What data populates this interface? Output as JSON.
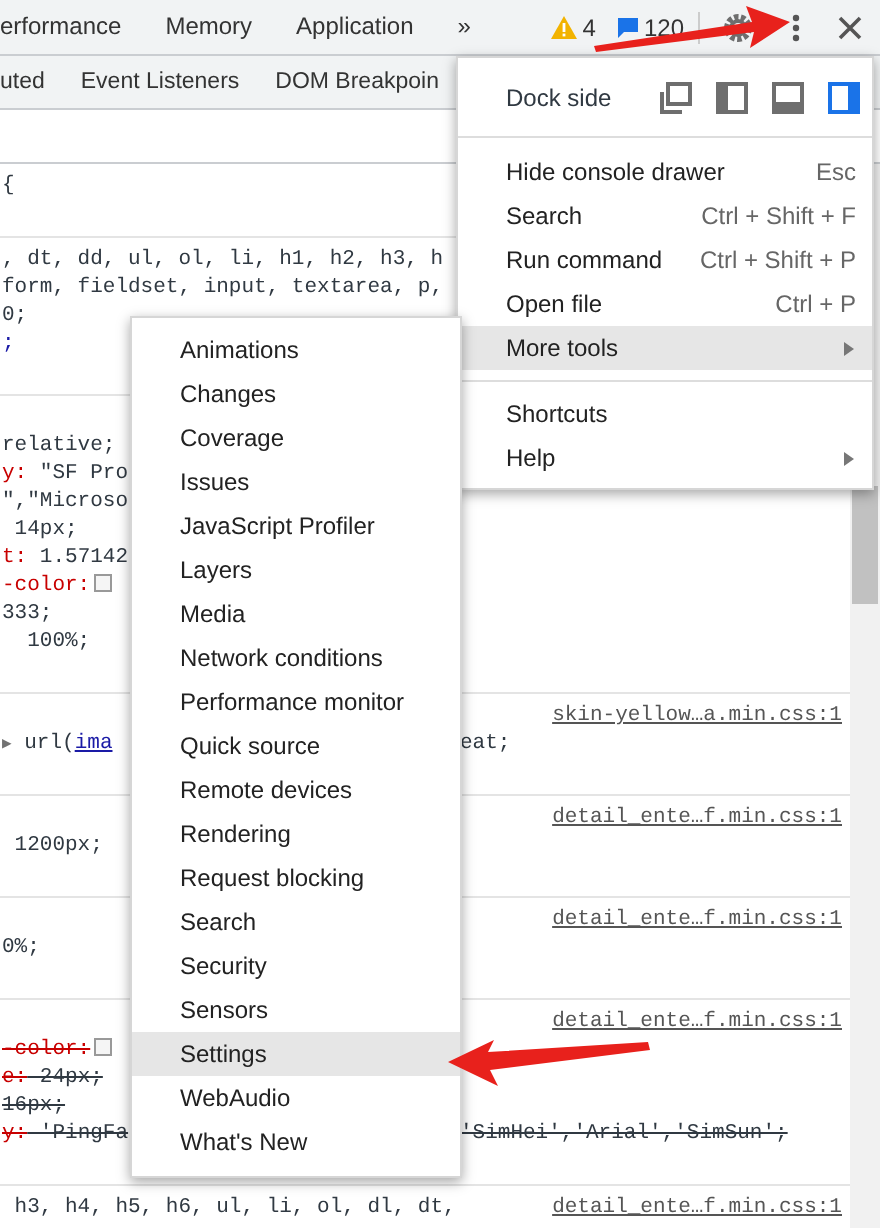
{
  "toolbar": {
    "tabs": [
      {
        "label": "erformance"
      },
      {
        "label": "Memory"
      },
      {
        "label": "Application"
      }
    ],
    "overflow": "»",
    "warnings": "4",
    "messages": "120"
  },
  "subtabs": [
    {
      "label": "uted"
    },
    {
      "label": "Event Listeners"
    },
    {
      "label": "DOM Breakpoin"
    }
  ],
  "rules": [
    {
      "header": [
        {
          "kind": "value",
          "text": "{"
        }
      ]
    },
    {
      "header": [
        {
          "kind": "value",
          "text": ", dt, dd, ul, ol, li, h1, h2, h3, h"
        }
      ],
      "lines": [
        {
          "struck": false,
          "segments": [
            {
              "kind": "value",
              "text": "form, fieldset, input, textarea, p,"
            }
          ]
        },
        {
          "struck": false,
          "segments": [
            {
              "kind": "value",
              "text": "0;"
            }
          ]
        },
        {
          "struck": false,
          "segments": [
            {
              "kind": "punct",
              "text": ";"
            }
          ]
        }
      ]
    },
    {
      "lines": [
        {
          "struck": false,
          "segments": [
            {
              "kind": "value",
              "text": "relative;"
            }
          ]
        },
        {
          "struck": false,
          "segments": [
            {
              "kind": "prop",
              "text": "y:"
            },
            {
              "kind": "value",
              "text": " \"SF Pro"
            }
          ]
        },
        {
          "struck": false,
          "segments": [
            {
              "kind": "value",
              "text": "\",\"Microso"
            }
          ]
        },
        {
          "struck": false,
          "segments": [
            {
              "kind": "value",
              "text": " 14px;"
            }
          ]
        },
        {
          "struck": false,
          "segments": [
            {
              "kind": "prop",
              "text": "t:"
            },
            {
              "kind": "value",
              "text": " 1.57142"
            }
          ]
        },
        {
          "struck": false,
          "segments": [
            {
              "kind": "prop",
              "text": "-color:"
            },
            {
              "kind": "swatch"
            }
          ]
        },
        {
          "struck": false,
          "segments": [
            {
              "kind": "value",
              "text": "333;"
            }
          ]
        },
        {
          "struck": false,
          "segments": [
            {
              "kind": "value",
              "text": "  100%;"
            }
          ]
        }
      ]
    },
    {
      "source": "skin-yellow…a.min.css:1",
      "lines": [
        {
          "struck": false,
          "segments": [
            {
              "kind": "toggle",
              "text": "▶"
            },
            {
              "kind": "value",
              "text": " url("
            },
            {
              "kind": "link",
              "text": "ima"
            }
          ],
          "right": [
            {
              "kind": "value",
              "text": "eat;"
            }
          ]
        }
      ]
    },
    {
      "source": "detail_ente…f.min.css:1",
      "lines": [
        {
          "struck": false,
          "segments": [
            {
              "kind": "value",
              "text": " 1200px;"
            }
          ]
        }
      ]
    },
    {
      "source": "detail_ente…f.min.css:1",
      "lines": [
        {
          "struck": false,
          "segments": [
            {
              "kind": "value",
              "text": "0%;"
            }
          ]
        }
      ]
    },
    {
      "source": "detail_ente…f.min.css:1",
      "lines": [
        {
          "struck": true,
          "segments": [
            {
              "kind": "prop",
              "text": "-color:"
            },
            {
              "kind": "swatch"
            }
          ]
        },
        {
          "struck": true,
          "segments": [
            {
              "kind": "prop",
              "text": "e:"
            },
            {
              "kind": "value",
              "text": " 24px;"
            }
          ]
        },
        {
          "struck": true,
          "segments": [
            {
              "kind": "value",
              "text": "16px;"
            }
          ]
        },
        {
          "struck": true,
          "segments": [
            {
              "kind": "prop",
              "text": "y:"
            },
            {
              "kind": "value",
              "text": " 'PingFa"
            }
          ],
          "right": [
            {
              "kind": "value",
              "text": "'SimHei','Arial','SimSun';"
            }
          ]
        }
      ]
    },
    {
      "header": [
        {
          "kind": "value",
          "text": " h3, h4, h5, h6, ul, li, ol, dl, dt,"
        }
      ],
      "source": "detail_ente…f.min.css:1"
    }
  ],
  "main_menu": {
    "dock_label": "Dock side",
    "dock_options": [
      {
        "kind": "undock",
        "selected": false
      },
      {
        "kind": "left",
        "selected": false
      },
      {
        "kind": "bottom",
        "selected": false
      },
      {
        "kind": "right",
        "selected": true
      }
    ],
    "groups": [
      [
        {
          "label": "Hide console drawer",
          "shortcut": "Esc",
          "has_submenu": false,
          "highlighted": false
        },
        {
          "label": "Search",
          "shortcut": "Ctrl + Shift + F",
          "has_submenu": false,
          "highlighted": false
        },
        {
          "label": "Run command",
          "shortcut": "Ctrl + Shift + P",
          "has_submenu": false,
          "highlighted": false
        },
        {
          "label": "Open file",
          "shortcut": "Ctrl + P",
          "has_submenu": false,
          "highlighted": false
        },
        {
          "label": "More tools",
          "has_submenu": true,
          "highlighted": true
        }
      ],
      [
        {
          "label": "Shortcuts",
          "has_submenu": false,
          "highlighted": false
        },
        {
          "label": "Help",
          "has_submenu": true,
          "highlighted": false
        }
      ]
    ]
  },
  "more_tools_menu": {
    "items": [
      {
        "label": "Animations",
        "highlighted": false
      },
      {
        "label": "Changes",
        "highlighted": false
      },
      {
        "label": "Coverage",
        "highlighted": false
      },
      {
        "label": "Issues",
        "highlighted": false
      },
      {
        "label": "JavaScript Profiler",
        "highlighted": false
      },
      {
        "label": "Layers",
        "highlighted": false
      },
      {
        "label": "Media",
        "highlighted": false
      },
      {
        "label": "Network conditions",
        "highlighted": false
      },
      {
        "label": "Performance monitor",
        "highlighted": false
      },
      {
        "label": "Quick source",
        "highlighted": false
      },
      {
        "label": "Remote devices",
        "highlighted": false
      },
      {
        "label": "Rendering",
        "highlighted": false
      },
      {
        "label": "Request blocking",
        "highlighted": false
      },
      {
        "label": "Search",
        "highlighted": false
      },
      {
        "label": "Security",
        "highlighted": false
      },
      {
        "label": "Sensors",
        "highlighted": false
      },
      {
        "label": "Settings",
        "highlighted": true
      },
      {
        "label": "WebAudio",
        "highlighted": false
      },
      {
        "label": "What's New",
        "highlighted": false
      }
    ]
  }
}
